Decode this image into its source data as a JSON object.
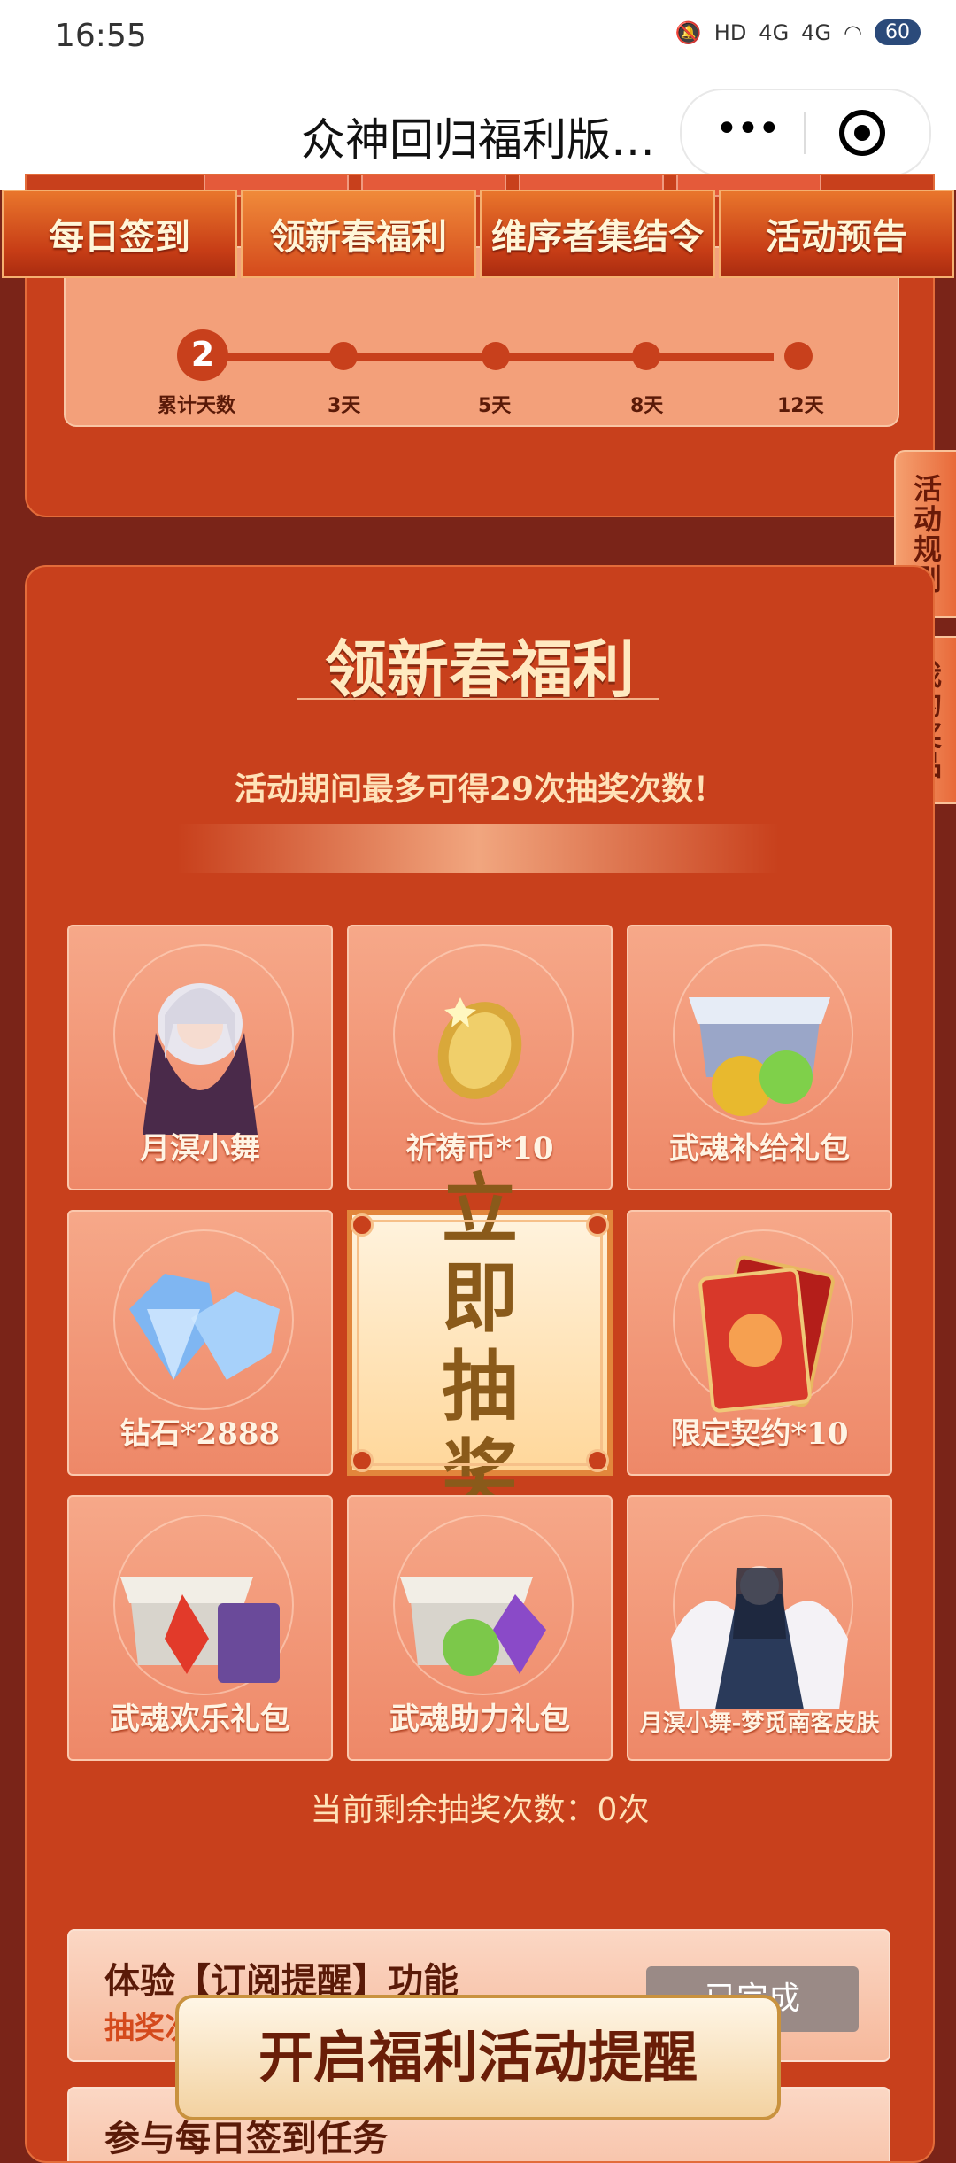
{
  "status_bar": {
    "time": "16:55",
    "signal_1": "HD",
    "signal_2": "4G",
    "signal_3": "4G",
    "battery": "60"
  },
  "title_bar": {
    "title": "众神回归福利版…",
    "more_label": "•••"
  },
  "tabs": [
    "每日签到",
    "领新春福利",
    "维序者集结令",
    "活动预告"
  ],
  "progress": {
    "current_days": "2",
    "label": "累计天数",
    "milestones": [
      "3天",
      "5天",
      "8天",
      "12天"
    ]
  },
  "side_tabs": {
    "rules": "活动规则",
    "my_prizes": "我的奖品"
  },
  "section": {
    "title": "领新春福利",
    "subtitle": "活动期间最多可得29次抽奖次数！",
    "prizes": [
      {
        "label": "月溟小舞",
        "icon": "character-icon"
      },
      {
        "label": "祈祷币*10",
        "icon": "coin-icon"
      },
      {
        "label": "武魂补给礼包",
        "icon": "gift-chest-icon"
      },
      {
        "label": "钻石*2888",
        "icon": "diamond-icon"
      },
      {
        "label": "限定契约*10",
        "icon": "card-icon"
      },
      {
        "label": "武魂欢乐礼包",
        "icon": "gift-chest-icon"
      },
      {
        "label": "武魂助力礼包",
        "icon": "gift-chest-icon"
      },
      {
        "label": "月溟小舞-梦觅南客皮肤",
        "icon": "character-icon"
      }
    ],
    "draw_button": "立即抽奖",
    "remaining": "当前剩余抽奖次数：0次"
  },
  "tasks": [
    {
      "name": "体验【订阅提醒】功能",
      "sub": "抽奖次",
      "button": "已完成"
    },
    {
      "name": "参与每日签到任务"
    }
  ],
  "reminder_button": "开启福利活动提醒",
  "colors": {
    "primary_red": "#c8401c",
    "gold_text": "#ffe9c0",
    "dark_bg": "#7a2418"
  }
}
